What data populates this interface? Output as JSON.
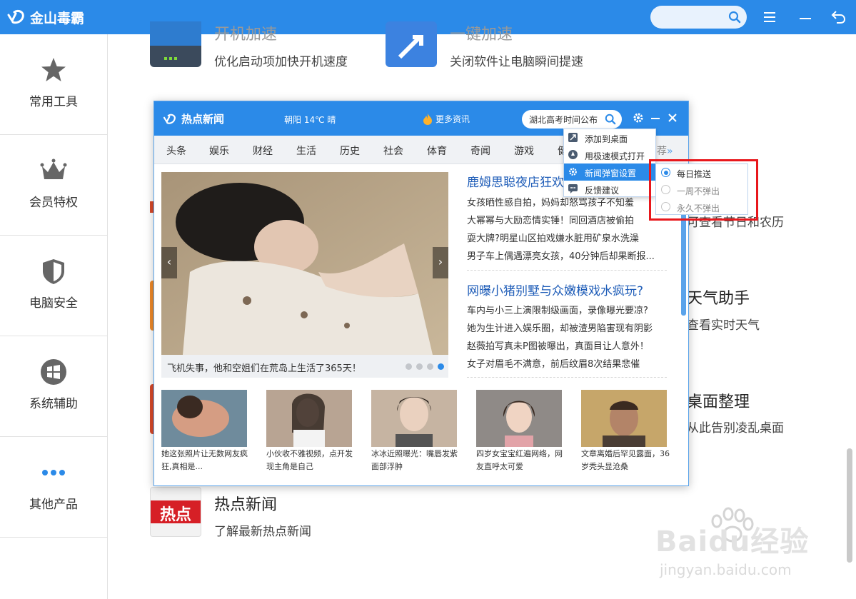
{
  "app": {
    "title": "金山毒霸"
  },
  "topbar": {
    "search_placeholder": ""
  },
  "sidebar": {
    "items": [
      {
        "label": "常用工具",
        "icon": "star-icon"
      },
      {
        "label": "会员特权",
        "icon": "crown-icon"
      },
      {
        "label": "电脑安全",
        "icon": "shield-icon"
      },
      {
        "label": "系统辅助",
        "icon": "windows-icon"
      },
      {
        "label": "其他产品",
        "icon": "more-dots-icon"
      }
    ]
  },
  "tools": {
    "boot": {
      "title": "开机加速",
      "desc": "优化启动项加快开机速度"
    },
    "speed": {
      "title": "一键加速",
      "desc": "关闭软件让电脑瞬间提速"
    },
    "calendar": {
      "desc": "可查看节日和农历"
    },
    "weather": {
      "title": "天气助手",
      "desc": "查看实时天气"
    },
    "desktop": {
      "title": "桌面整理",
      "desc": "从此告别凌乱桌面"
    },
    "news": {
      "title": "热点新闻",
      "desc": "了解最新热点新闻",
      "icon_text": "热点"
    }
  },
  "popup": {
    "title": "热点新闻",
    "weather": "朝阳  14℃ 晴",
    "more_news": "更多资讯",
    "search_value": "湖北高考时间公布",
    "tabs": [
      "头条",
      "娱乐",
      "财经",
      "生活",
      "历史",
      "社会",
      "体育",
      "奇闻",
      "游戏",
      "健"
    ],
    "tab_more": "荐",
    "slide_caption": "飞机失事，他和空姐们在荒岛上生活了365天！",
    "slide_count": 4,
    "slide_active": 4,
    "articles": [
      {
        "title": "鹿姆思聪夜店狂欢",
        "lines": [
          "女孩晒性感自拍，妈妈却怒骂孩子不知羞",
          "大幂幂与大励恋情实锤！同回酒店被偷拍",
          "耍大牌?明星山区拍戏嫌水脏用矿泉水洗澡",
          "男子车上偶遇漂亮女孩，40分钟后却果断报..."
        ]
      },
      {
        "title": "网曝小猪别墅与众嫩模戏水疯玩?",
        "lines": [
          "车内与小三上演限制级画面，录像曝光要凉?",
          "她为生计进入娱乐圈，却被渣男陷害现有阴影",
          "赵薇拍写真未P图被曝出，真面目让人意外！",
          "女子对眉毛不满意，前后纹眉8次结果悲催"
        ]
      }
    ],
    "thumbs": [
      {
        "caption": "她这张照片让无数网友疯狂,真相是..."
      },
      {
        "caption": "小伙收不雅视频，点开发现主角是自己"
      },
      {
        "caption": "冰冰近照曝光：嘴唇发紫 面部浮肿"
      },
      {
        "caption": "四岁女宝宝红遍网络，网友直呼太可爱"
      },
      {
        "caption": "文章离婚后罕见露面，36岁秃头显沧桑"
      }
    ]
  },
  "menu": {
    "items": [
      {
        "label": "添加到桌面",
        "icon": "desktop-icon"
      },
      {
        "label": "用极速模式打开",
        "icon": "rocket-icon"
      },
      {
        "label": "新闻弹窗设置",
        "icon": "gear-icon",
        "active": true
      },
      {
        "label": "反馈建议",
        "icon": "feedback-icon"
      }
    ]
  },
  "submenu": {
    "options": [
      {
        "label": "每日推送",
        "selected": true
      },
      {
        "label": "一周不弹出",
        "selected": false
      },
      {
        "label": "永久不弹出",
        "selected": false
      }
    ]
  },
  "watermark": {
    "brand": "Baidu经验",
    "url": "jingyan.baidu.com"
  },
  "colors": {
    "accent": "#2b8ae8",
    "title_link": "#1f5db8",
    "highlight": "#e8171c"
  }
}
